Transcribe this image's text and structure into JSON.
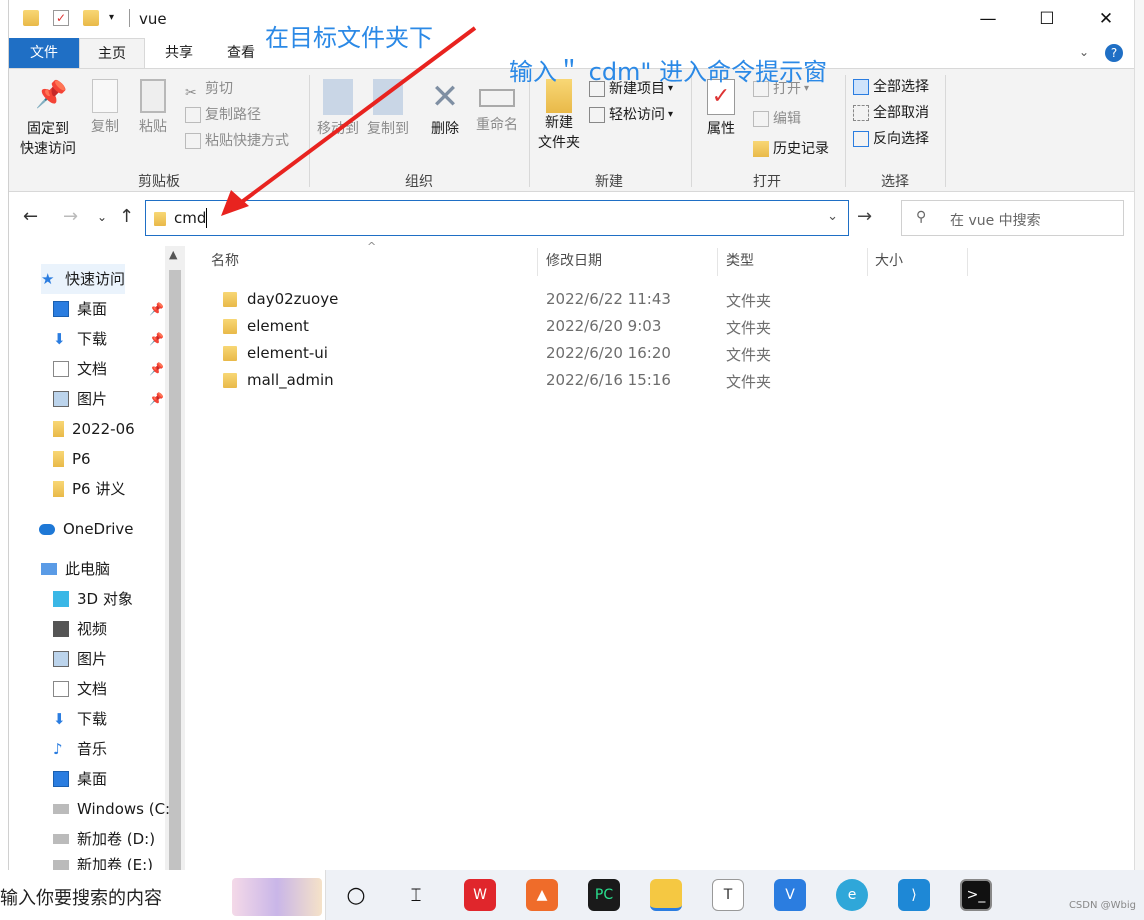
{
  "window": {
    "title": "vue"
  },
  "ribbon_tabs": [
    "文件",
    "主页",
    "共享",
    "查看"
  ],
  "ribbon": {
    "clipboard": {
      "label": "剪贴板",
      "pin_label": "固定到\n快速访问",
      "copy_label": "复制",
      "paste_label": "粘贴",
      "cut_label": "剪切",
      "copy_path_label": "复制路径",
      "paste_shortcut_label": "粘贴快捷方式"
    },
    "organize": {
      "label": "组织",
      "move_to_label": "移动到",
      "copy_to_label": "复制到",
      "delete_label": "删除",
      "rename_label": "重命名"
    },
    "new": {
      "label": "新建",
      "new_folder_label": "新建\n文件夹",
      "new_item_label": "新建项目",
      "easy_access_label": "轻松访问"
    },
    "open": {
      "label": "打开",
      "properties_label": "属性",
      "open_label": "打开",
      "edit_label": "编辑",
      "history_label": "历史记录"
    },
    "select": {
      "label": "选择",
      "select_all_label": "全部选择",
      "select_none_label": "全部取消",
      "invert_label": "反向选择"
    }
  },
  "address": {
    "value": "cmd"
  },
  "search": {
    "placeholder": "在 vue 中搜索"
  },
  "sidebar": {
    "items": [
      {
        "label": "快速访问",
        "icon": "star-icon"
      },
      {
        "label": "桌面",
        "icon": "desktop-icon",
        "pinned": true
      },
      {
        "label": "下载",
        "icon": "download-icon",
        "pinned": true
      },
      {
        "label": "文档",
        "icon": "document-icon",
        "pinned": true
      },
      {
        "label": "图片",
        "icon": "picture-icon",
        "pinned": true
      },
      {
        "label": "2022-06",
        "icon": "folder-icon"
      },
      {
        "label": "P6",
        "icon": "folder-icon"
      },
      {
        "label": "P6 讲义",
        "icon": "folder-icon"
      },
      {
        "label": "OneDrive",
        "icon": "cloud-icon"
      },
      {
        "label": "此电脑",
        "icon": "computer-icon"
      },
      {
        "label": "3D 对象",
        "icon": "cube-icon"
      },
      {
        "label": "视频",
        "icon": "video-icon"
      },
      {
        "label": "图片",
        "icon": "picture-icon"
      },
      {
        "label": "文档",
        "icon": "document-icon"
      },
      {
        "label": "下载",
        "icon": "download-icon"
      },
      {
        "label": "音乐",
        "icon": "music-icon"
      },
      {
        "label": "桌面",
        "icon": "desktop-icon"
      },
      {
        "label": "Windows (C:",
        "icon": "drive-icon"
      },
      {
        "label": "新加卷 (D:)",
        "icon": "drive-icon"
      },
      {
        "label": "新加卷 (E:)",
        "icon": "drive-icon"
      }
    ]
  },
  "columns": [
    "名称",
    "修改日期",
    "类型",
    "大小"
  ],
  "files": [
    {
      "name": "day02zuoye",
      "modified": "2022/6/22 11:43",
      "type": "文件夹"
    },
    {
      "name": "element",
      "modified": "2022/6/20 9:03",
      "type": "文件夹"
    },
    {
      "name": "element-ui",
      "modified": "2022/6/20 16:20",
      "type": "文件夹"
    },
    {
      "name": "mall_admin",
      "modified": "2022/6/16 15:16",
      "type": "文件夹"
    }
  ],
  "annotations": {
    "top": "在目标文件夹下",
    "mid": "输入＂ cdm\" 进入命令提示窗"
  },
  "taskbar": {
    "search_text": "输入你要搜索的内容",
    "watermark": "CSDN @Wbig"
  },
  "colors": {
    "accent": "#1f6fc5",
    "annotation": "#2b89e6",
    "arrow": "#e8231f"
  }
}
